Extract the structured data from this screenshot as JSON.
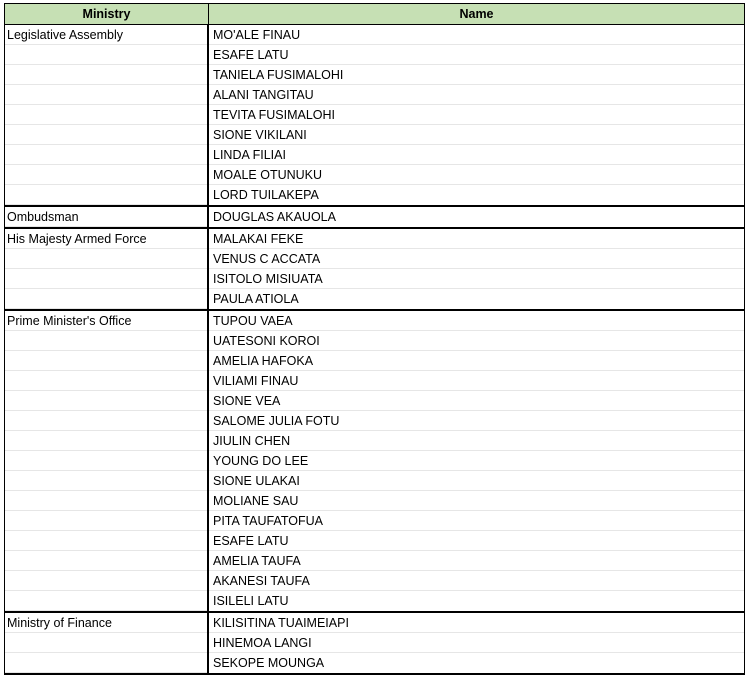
{
  "table": {
    "headers": {
      "ministry": "Ministry",
      "name": "Name"
    },
    "groups": [
      {
        "ministry": "Legislative Assembly",
        "names": [
          "MO'ALE FINAU",
          "ESAFE LATU",
          "TANIELA FUSIMALOHI",
          "ALANI TANGITAU",
          "TEVITA FUSIMALOHI",
          "SIONE VIKILANI",
          "LINDA FILIAI",
          "MOALE OTUNUKU",
          "LORD TUILAKEPA"
        ]
      },
      {
        "ministry": "Ombudsman",
        "names": [
          "DOUGLAS AKAUOLA"
        ]
      },
      {
        "ministry": "His Majesty Armed Force",
        "names": [
          "MALAKAI FEKE",
          "VENUS C ACCATA",
          "ISITOLO MISIUATA",
          "PAULA ATIOLA"
        ]
      },
      {
        "ministry": "Prime Minister's Office",
        "names": [
          "TUPOU VAEA",
          "UATESONI KOROI",
          "AMELIA HAFOKA",
          "VILIAMI FINAU",
          "SIONE VEA",
          "SALOME JULIA FOTU",
          "JIULIN CHEN",
          "YOUNG DO LEE",
          "SIONE ULAKAI",
          "MOLIANE SAU",
          "PITA TAUFATOFUA",
          "ESAFE LATU",
          "AMELIA TAUFA",
          "AKANESI TAUFA",
          "ISILELI LATU"
        ]
      },
      {
        "ministry": "Ministry of Finance",
        "names": [
          "KILISITINA TUAIMEIAPI",
          "HINEMOA LANGI",
          "SEKOPE MOUNGA"
        ]
      }
    ]
  },
  "colors": {
    "header_background": "#c6e0b4",
    "border": "#000000",
    "gridline": "#e6e6e6"
  }
}
